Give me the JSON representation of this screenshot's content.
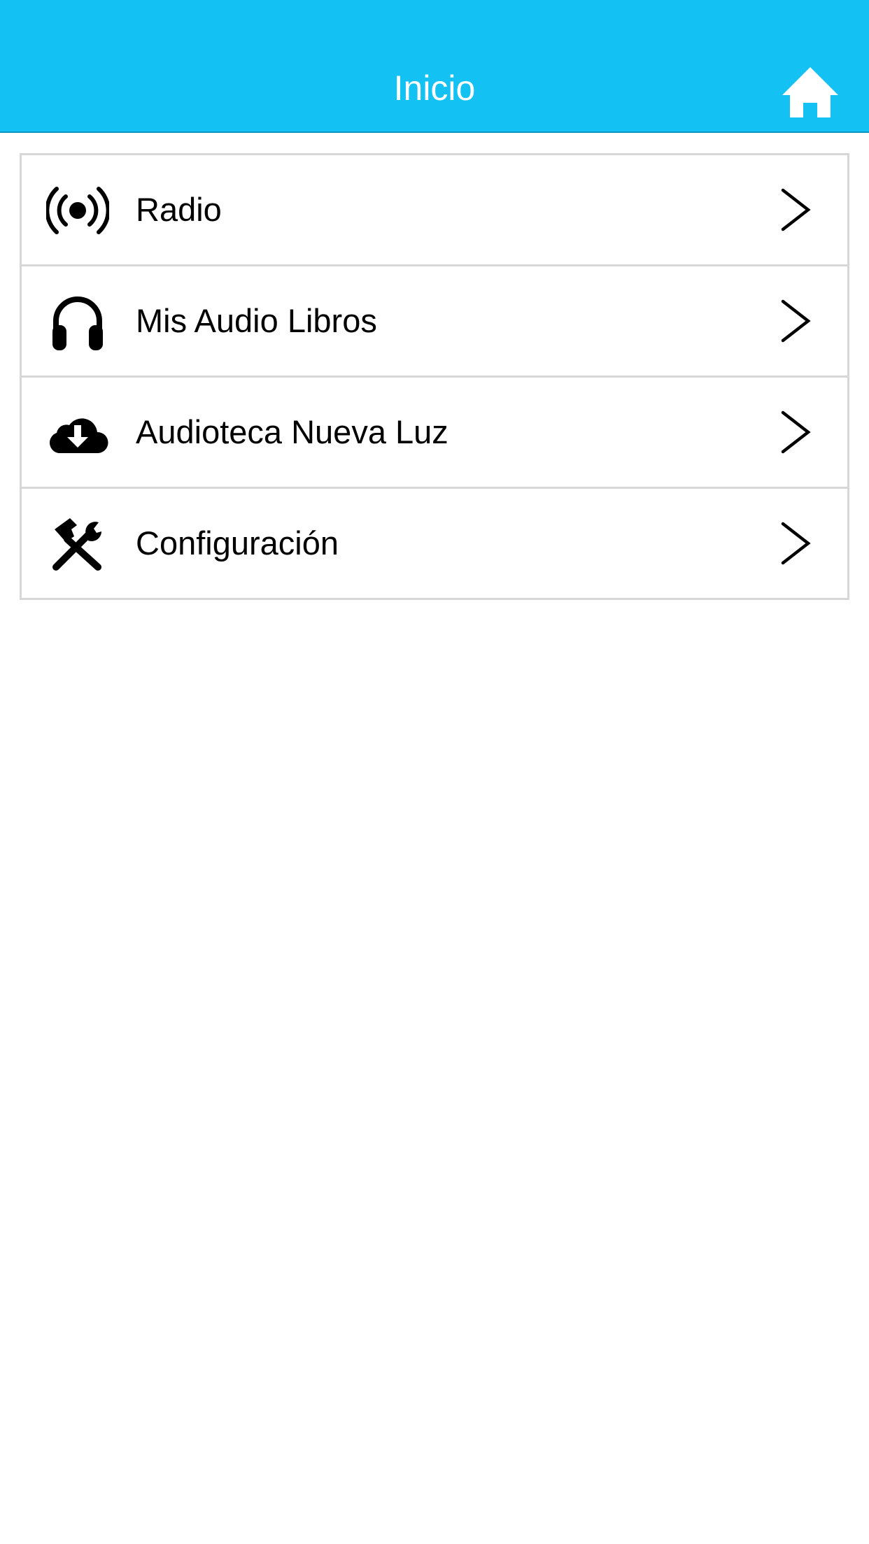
{
  "header": {
    "title": "Inicio",
    "home_icon": "home-icon",
    "background": "#13c1f2"
  },
  "menu": {
    "items": [
      {
        "label": "Radio",
        "icon": "broadcast-icon"
      },
      {
        "label": "Mis Audio Libros",
        "icon": "headphones-icon"
      },
      {
        "label": "Audioteca Nueva Luz",
        "icon": "cloud-download-icon"
      },
      {
        "label": "Configuración",
        "icon": "tools-icon"
      }
    ],
    "chevron_icon": "chevron-right-icon",
    "border_color": "#d7d7d7"
  }
}
